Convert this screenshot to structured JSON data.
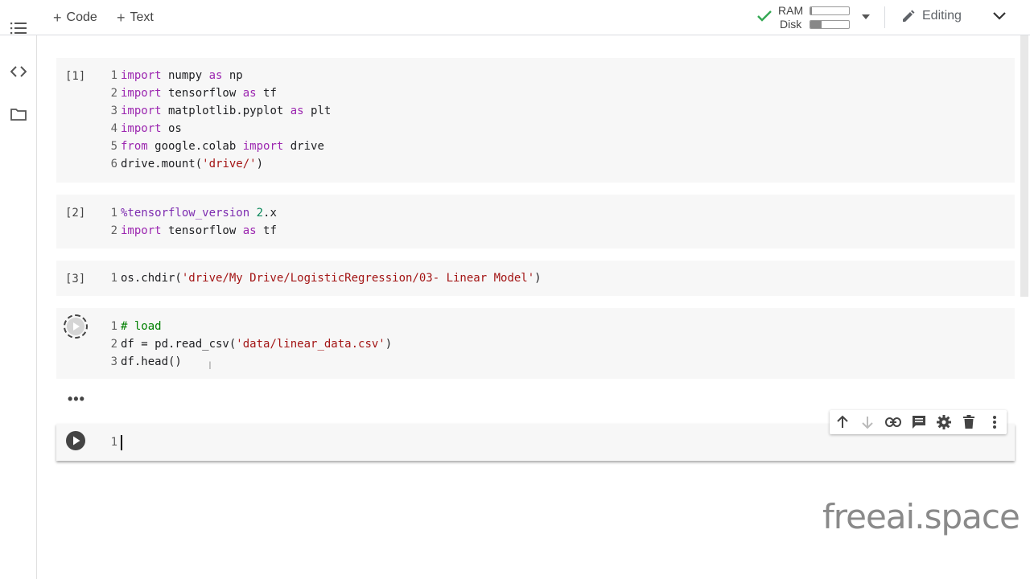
{
  "toolbar": {
    "add_code_label": "Code",
    "add_text_label": "Text",
    "ram_label": "RAM",
    "disk_label": "Disk",
    "ram_usage": 0.05,
    "disk_usage": 0.3,
    "editing_label": "Editing"
  },
  "cells": [
    {
      "prompt": "[1]",
      "lines": [
        {
          "n": "1",
          "code": "import numpy as np"
        },
        {
          "n": "2",
          "code": "import tensorflow as tf"
        },
        {
          "n": "3",
          "code": "import matplotlib.pyplot as plt"
        },
        {
          "n": "4",
          "code": "import os"
        },
        {
          "n": "5",
          "code": "from google.colab import drive"
        },
        {
          "n": "6",
          "code": "drive.mount('drive/')"
        }
      ]
    },
    {
      "prompt": "[2]",
      "lines": [
        {
          "n": "1",
          "code": "%tensorflow_version 2.x"
        },
        {
          "n": "2",
          "code": "import tensorflow as tf"
        }
      ]
    },
    {
      "prompt": "[3]",
      "lines": [
        {
          "n": "1",
          "code": "os.chdir('drive/My Drive/LogisticRegression/03- Linear Model')"
        }
      ]
    },
    {
      "prompt": "",
      "lines": [
        {
          "n": "1",
          "code": "# load"
        },
        {
          "n": "2",
          "code": "df = pd.read_csv('data/linear_data.csv')"
        },
        {
          "n": "3",
          "code": "df.head()"
        }
      ]
    }
  ],
  "output_ellipsis": "•••",
  "active_cell": {
    "line_number": "1"
  },
  "watermark": "freeai.space",
  "colors": {
    "keyword": "#9c27b0",
    "string": "#a31515",
    "number": "#09885a",
    "comment": "#008000",
    "check": "#34a853"
  }
}
